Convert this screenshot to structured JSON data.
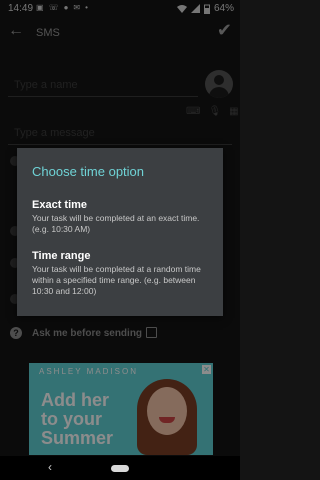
{
  "status_bar": {
    "time": "14:49",
    "battery": "64%"
  },
  "toolbar": {
    "title": "SMS"
  },
  "form": {
    "name_placeholder": "Type a name",
    "message_placeholder": "Type a message",
    "ask_label": "Ask me before sending"
  },
  "ad": {
    "brand": "ASHLEY MADISON",
    "headline": "Add her to your Summer"
  },
  "dialog": {
    "title": "Choose time option",
    "options": [
      {
        "title": "Exact time",
        "description": "Your task will be completed at an exact time. (e.g. 10:30 AM)"
      },
      {
        "title": "Time range",
        "description": "Your task will be completed at a random time within a specified time range. (e.g. between 10:30 and 12:00)"
      }
    ]
  },
  "colors": {
    "accent": "#6fd3d6",
    "dialog_bg": "#3c3f42",
    "ad_bg": "#5fd0d4"
  },
  "icons": [
    "back-arrow-icon",
    "check-icon",
    "contact-avatar-icon",
    "keyboard-icon",
    "microphone-icon",
    "grid-icon",
    "help-icon",
    "checkbox-icon",
    "wifi-icon",
    "signal-icon",
    "battery-icon",
    "nav-back-icon",
    "nav-home-icon"
  ]
}
